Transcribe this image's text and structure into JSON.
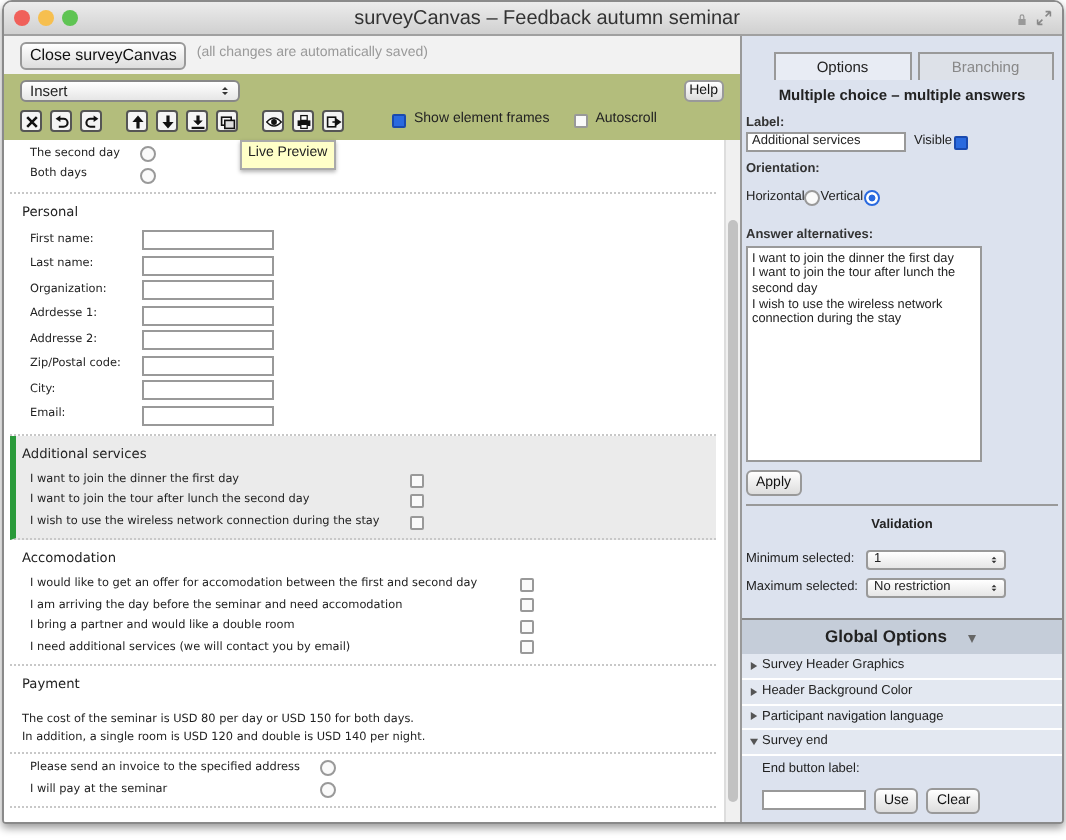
{
  "window": {
    "title": "surveyCanvas – Feedback autumn seminar"
  },
  "top_bar": {
    "close_button": "Close surveyCanvas",
    "note": "(all changes are automatically saved)"
  },
  "toolbar": {
    "insert_select": "Insert",
    "help_button": "Help",
    "tooltip": "Live Preview",
    "show_element_frames": {
      "label": "Show element frames",
      "checked": true
    },
    "autoscroll": {
      "label": "Autoscroll",
      "checked": false
    }
  },
  "canvas": {
    "sections": [
      {
        "kind": "radios",
        "selected": false,
        "options": [
          {
            "label": "The second day",
            "selected": false
          },
          {
            "label": "Both days",
            "selected": false
          }
        ]
      },
      {
        "kind": "fields",
        "selected": false,
        "title": "Personal",
        "fields": [
          {
            "label": "First name:"
          },
          {
            "label": "Last name:"
          },
          {
            "label": "Organization:"
          },
          {
            "label": "Adrdesse 1:"
          },
          {
            "label": "Addresse 2:"
          },
          {
            "label": "Zip/Postal code:"
          },
          {
            "label": "City:"
          },
          {
            "label": "Email:"
          }
        ]
      },
      {
        "kind": "checkboxes",
        "selected": true,
        "title": "Additional services",
        "options": [
          {
            "label": "I want to join the dinner the first day",
            "checked": false
          },
          {
            "label": "I want to join the tour after lunch the second day",
            "checked": false
          },
          {
            "label": "I wish to use the wireless network connection during the stay",
            "checked": false
          }
        ]
      },
      {
        "kind": "checkboxes",
        "selected": false,
        "title": "Accomodation",
        "options": [
          {
            "label": "I would like to get an offer for accomodation between the first and second day",
            "checked": false
          },
          {
            "label": "I am arriving the day before the seminar and need accomodation",
            "checked": false
          },
          {
            "label": "I bring a partner and would like a double room",
            "checked": false
          },
          {
            "label": "I need additional services (we will contact you by email)",
            "checked": false
          }
        ]
      },
      {
        "kind": "text",
        "selected": false,
        "title": "Payment",
        "paragraph": [
          "The cost of the seminar is USD 80 per day or USD 150 for both days.",
          "In addition, a single room is USD 120 and double is USD 140 per night."
        ]
      },
      {
        "kind": "radios",
        "selected": false,
        "options": [
          {
            "label": "Please send an invoice to the specified address",
            "selected": false
          },
          {
            "label": "I will pay at the seminar",
            "selected": false
          }
        ]
      }
    ]
  },
  "panel": {
    "tabs": [
      {
        "label": "Options",
        "selected": true
      },
      {
        "label": "Branching",
        "selected": false
      }
    ],
    "heading": "Multiple choice – multiple answers",
    "label_field": {
      "label": "Label:",
      "value": "Additional services",
      "visible_label": "Visible",
      "visible_checked": true
    },
    "orientation": {
      "label": "Orientation:",
      "options": [
        {
          "label": "Horizontal",
          "selected": false
        },
        {
          "label": "Vertical",
          "selected": true
        }
      ]
    },
    "answers": {
      "label": "Answer alternatives:",
      "value": "I want to join the dinner the first day\nI want to join the tour after lunch the second day\nI wish to use the wireless network connection during the stay"
    },
    "apply_button": "Apply",
    "validation": {
      "title": "Validation",
      "rows": [
        {
          "label": "Minimum selected:",
          "value": "1"
        },
        {
          "label": "Maximum selected:",
          "value": "No restriction"
        }
      ]
    },
    "global_options": {
      "title": "Global Options",
      "items": [
        {
          "label": "Survey Header Graphics",
          "expanded": false
        },
        {
          "label": "Header Background Color",
          "expanded": false
        },
        {
          "label": "Participant navigation language",
          "expanded": false
        },
        {
          "label": "Survey end",
          "expanded": true,
          "field_label": "End button label:",
          "buttons": [
            "Use",
            "Clear"
          ]
        }
      ]
    }
  }
}
